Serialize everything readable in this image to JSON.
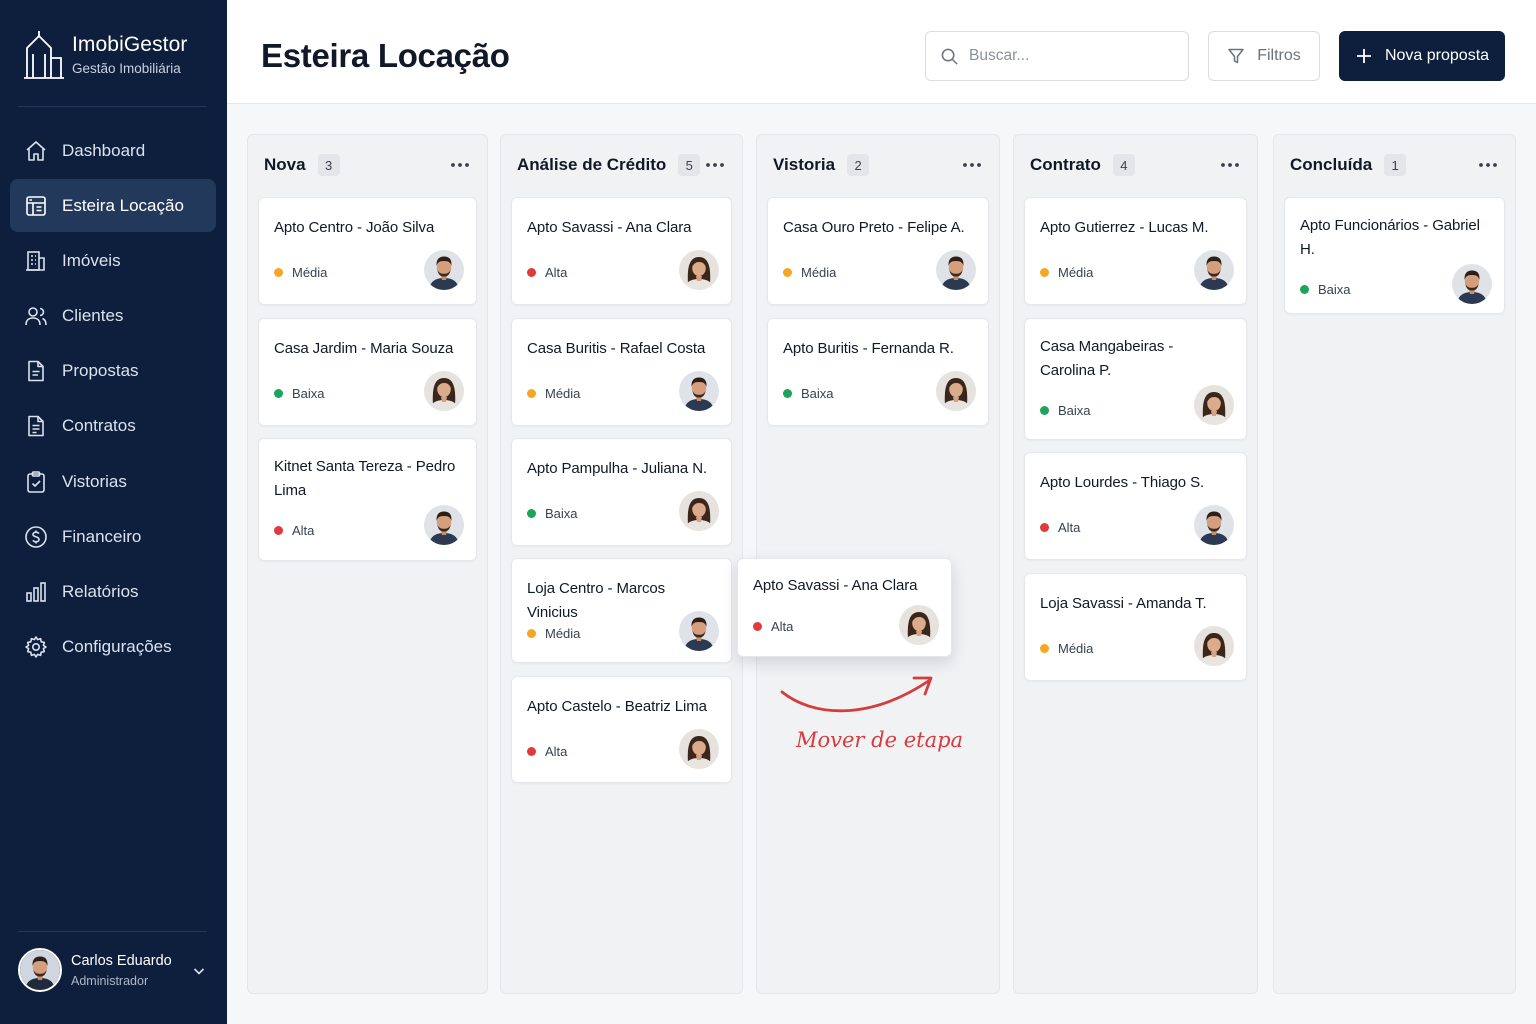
{
  "brand": {
    "name": "ImobiGestor",
    "subtitle": "Gestão Imobiliária"
  },
  "nav": [
    {
      "label": "Dashboard",
      "icon": "home-icon"
    },
    {
      "label": "Esteira Locação",
      "icon": "board-icon",
      "active": true
    },
    {
      "label": "Imóveis",
      "icon": "building-icon"
    },
    {
      "label": "Clientes",
      "icon": "users-icon"
    },
    {
      "label": "Propostas",
      "icon": "document-icon"
    },
    {
      "label": "Contratos",
      "icon": "contract-icon"
    },
    {
      "label": "Vistorias",
      "icon": "clipboard-check-icon"
    },
    {
      "label": "Financeiro",
      "icon": "dollar-icon"
    },
    {
      "label": "Relatórios",
      "icon": "bar-chart-icon"
    },
    {
      "label": "Configurações",
      "icon": "gear-icon"
    }
  ],
  "user": {
    "name": "Carlos Eduardo",
    "role": "Administrador"
  },
  "header": {
    "title": "Esteira Locação",
    "search_placeholder": "Buscar...",
    "filters_label": "Filtros",
    "new_label": "Nova proposta"
  },
  "colors": {
    "navy": "#0d1f3c",
    "alta": "#e03a3a",
    "media": "#f5a623",
    "baixa": "#1ea35a"
  },
  "columns": [
    {
      "title": "Nova",
      "count": "3",
      "cards": [
        {
          "title": "Apto Centro - João Silva",
          "priority": "Média",
          "avatar": "male"
        },
        {
          "title": "Casa Jardim - Maria Souza",
          "priority": "Baixa",
          "avatar": "female"
        },
        {
          "title": "Kitnet Santa Tereza - Pedro Lima",
          "priority": "Alta",
          "avatar": "male"
        }
      ]
    },
    {
      "title": "Análise de Crédito",
      "count": "5",
      "cards": [
        {
          "title": "Apto Savassi - Ana Clara",
          "priority": "Alta",
          "avatar": "female"
        },
        {
          "title": "Casa Buritis - Rafael Costa",
          "priority": "Média",
          "avatar": "male"
        },
        {
          "title": "Apto Pampulha - Juliana N.",
          "priority": "Baixa",
          "avatar": "female"
        },
        {
          "title": "Loja Centro - Marcos Vinicius",
          "priority": "Média",
          "avatar": "male"
        },
        {
          "title": "Apto Castelo - Beatriz Lima",
          "priority": "Alta",
          "avatar": "female"
        }
      ]
    },
    {
      "title": "Vistoria",
      "count": "2",
      "cards": [
        {
          "title": "Casa Ouro Preto - Felipe A.",
          "priority": "Média",
          "avatar": "male"
        },
        {
          "title": "Apto Buritis - Fernanda R.",
          "priority": "Baixa",
          "avatar": "female"
        }
      ]
    },
    {
      "title": "Contrato",
      "count": "4",
      "cards": [
        {
          "title": "Apto Gutierrez - Lucas M.",
          "priority": "Média",
          "avatar": "male"
        },
        {
          "title": "Casa Mangabeiras - Carolina P.",
          "priority": "Baixa",
          "avatar": "female"
        },
        {
          "title": "Apto Lourdes - Thiago S.",
          "priority": "Alta",
          "avatar": "male"
        },
        {
          "title": "Loja Savassi - Amanda T.",
          "priority": "Média",
          "avatar": "female"
        }
      ]
    },
    {
      "title": "Concluída",
      "count": "1",
      "cards": [
        {
          "title": "Apto Funcionários - Gabriel H.",
          "priority": "Baixa",
          "avatar": "male"
        }
      ]
    }
  ],
  "drag_card": {
    "title": "Apto Savassi - Ana Clara",
    "priority": "Alta",
    "avatar": "female"
  },
  "annotation": {
    "label": "Mover de etapa"
  }
}
